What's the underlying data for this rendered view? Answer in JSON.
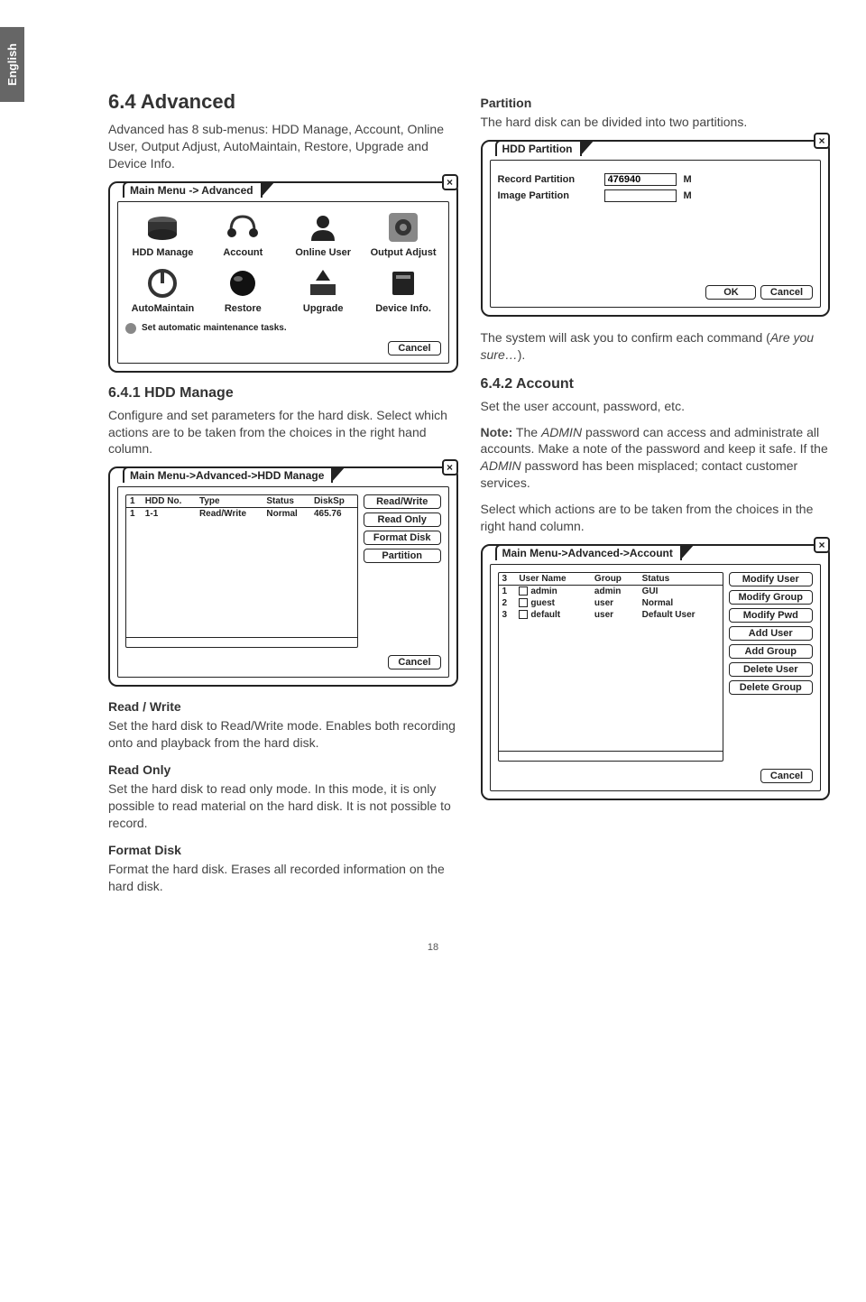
{
  "lang_tab": "English",
  "page_number": "18",
  "left": {
    "h1": "6.4 Advanced",
    "intro": "Advanced has 8 sub-menus: HDD Manage, Account, Online User, Output Adjust, AutoMaintain, Restore, Upgrade and Device Info.",
    "advanced_dialog": {
      "title": "Main Menu -> Advanced",
      "items": [
        "HDD Manage",
        "Account",
        "Online User",
        "Output Adjust",
        "AutoMaintain",
        "Restore",
        "Upgrade",
        "Device Info."
      ],
      "status": "Set automatic maintenance tasks.",
      "cancel": "Cancel"
    },
    "h2_hdd": "6.4.1 HDD Manage",
    "hdd_text": "Configure and set parameters for the hard disk. Select which actions are to be taken from the choices in the right hand column.",
    "hdd_dialog": {
      "title": "Main Menu->Advanced->HDD Manage",
      "headers": [
        "1",
        "HDD No.",
        "Type",
        "Status",
        "DiskSp"
      ],
      "row": [
        "1",
        "1-1",
        "Read/Write",
        "Normal",
        "465.76"
      ],
      "buttons": [
        "Read/Write",
        "Read Only",
        "Format Disk",
        "Partition"
      ],
      "cancel": "Cancel"
    },
    "rw_head": "Read / Write",
    "rw_text": "Set the hard disk to Read/Write mode. Enables both recording onto and playback from the hard disk.",
    "ro_head": "Read Only",
    "ro_text": "Set the hard disk to read only mode. In this mode, it is only possible to read material on the hard disk. It is not possible to record.",
    "fd_head": "Format Disk",
    "fd_text": "Format the hard disk. Erases all recorded information on the hard disk."
  },
  "right": {
    "part_head": "Partition",
    "part_text": "The hard disk can be divided into two partitions.",
    "part_dialog": {
      "title": "HDD Partition",
      "record_label": "Record Partition",
      "record_value": "476940",
      "image_label": "Image Partition",
      "unit": "M",
      "ok": "OK",
      "cancel": "Cancel"
    },
    "confirm_text_a": "The system will ask you to confirm each command (",
    "confirm_text_b": "Are you sure…",
    "confirm_text_c": ").",
    "h2_acct": "6.4.2 Account",
    "acct_text1": "Set the user account, password, etc.",
    "note_bold": "Note:",
    "note_text_a": " The ",
    "note_text_b": "ADMIN",
    "note_text_c": " password can access and administrate all accounts. Make a note of the password and keep it safe. If the ",
    "note_text_d": "ADMIN",
    "note_text_e": " password has been misplaced; contact customer services.",
    "acct_text2": "Select which actions are to be taken from the choices in the right hand column.",
    "acct_dialog": {
      "title": "Main Menu->Advanced->Account",
      "headers": [
        "3",
        "User Name",
        "Group",
        "Status"
      ],
      "rows": [
        [
          "1",
          "admin",
          "admin",
          "GUI"
        ],
        [
          "2",
          "guest",
          "user",
          "Normal"
        ],
        [
          "3",
          "default",
          "user",
          "Default User"
        ]
      ],
      "buttons": [
        "Modify User",
        "Modify Group",
        "Modify Pwd",
        "Add User",
        "Add Group",
        "Delete User",
        "Delete Group"
      ],
      "cancel": "Cancel"
    }
  }
}
